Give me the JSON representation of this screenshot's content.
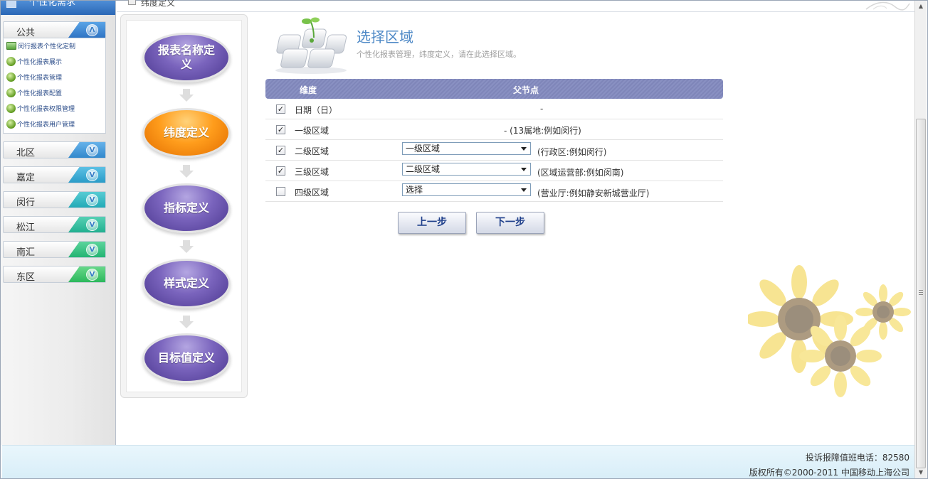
{
  "sidebar": {
    "header_title": "个性化需求",
    "groups": [
      {
        "label": "公共",
        "toggle": "Λ",
        "color": "#3a86d0"
      },
      {
        "label": "北区",
        "toggle": "V",
        "color": "#3a9ad8"
      },
      {
        "label": "嘉定",
        "toggle": "V",
        "color": "#2ba7d0"
      },
      {
        "label": "闵行",
        "toggle": "V",
        "color": "#27b2c0"
      },
      {
        "label": "松江",
        "toggle": "V",
        "color": "#28b8a0"
      },
      {
        "label": "南汇",
        "toggle": "V",
        "color": "#2cbc84"
      },
      {
        "label": "东区",
        "toggle": "V",
        "color": "#33c06c"
      }
    ],
    "sub_items": [
      {
        "label": "闵行报表个性化定制",
        "icon": "report-card-icon"
      },
      {
        "label": "个性化报表展示",
        "icon": "globe-icon"
      },
      {
        "label": "个性化报表管理",
        "icon": "globe-icon"
      },
      {
        "label": "个性化报表配置",
        "icon": "globe-icon"
      },
      {
        "label": "个性化报表权限管理",
        "icon": "globe-icon"
      },
      {
        "label": "个性化报表用户管理",
        "icon": "globe-icon"
      }
    ]
  },
  "topbar": {
    "title": "纬度定义"
  },
  "steps": [
    {
      "label": "报表名称定义",
      "active": false
    },
    {
      "label": "纬度定义",
      "active": true
    },
    {
      "label": "指标定义",
      "active": false
    },
    {
      "label": "样式定义",
      "active": false
    },
    {
      "label": "目标值定义",
      "active": false
    }
  ],
  "main": {
    "title": "选择区域",
    "subtitle": "个性化报表管理，纬度定义，请在此选择区域。",
    "table": {
      "col_dimension": "维度",
      "col_parent": "父节点",
      "rows": [
        {
          "checked": true,
          "name": "日期（日）",
          "parent": "-",
          "select": null,
          "hint": ""
        },
        {
          "checked": true,
          "name": "一级区域",
          "parent": "- (13属地:例如闵行)",
          "select": null,
          "hint": ""
        },
        {
          "checked": true,
          "name": "二级区域",
          "parent": "",
          "select": "一级区域",
          "hint": "(行政区:例如闵行)"
        },
        {
          "checked": true,
          "name": "三级区域",
          "parent": "",
          "select": "二级区域",
          "hint": "(区域运营部:例如闵南)"
        },
        {
          "checked": false,
          "name": "四级区域",
          "parent": "",
          "select": "选择",
          "hint": "(营业厅:例如静安新城营业厅)"
        }
      ]
    },
    "buttons": {
      "prev": "上一步",
      "next": "下一步"
    }
  },
  "footer": {
    "hotline": "投诉报障值班电话：82580",
    "copyright": "版权所有©2000-2011 中国移动上海公司"
  },
  "colors": {
    "accent": "#4d88c6",
    "step_active": "#ff9d1c",
    "step_inactive": "#6a55b0",
    "table_header": "#8389bd"
  }
}
